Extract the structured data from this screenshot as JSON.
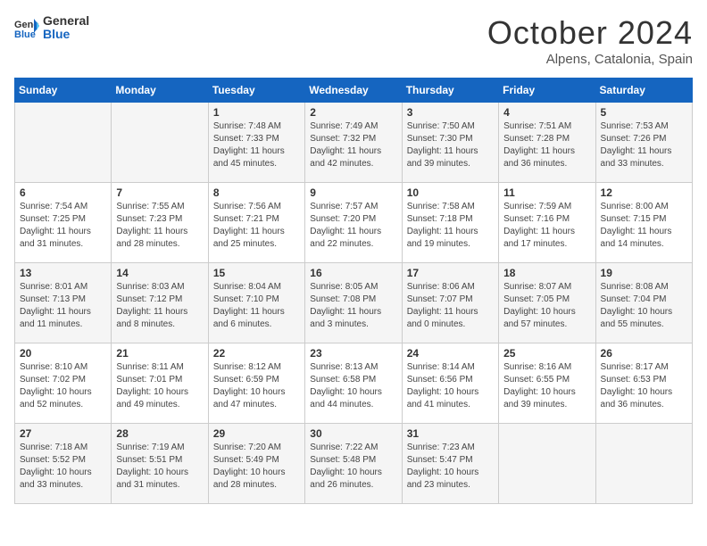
{
  "header": {
    "logo": {
      "general": "General",
      "blue": "Blue"
    },
    "title": "October 2024",
    "subtitle": "Alpens, Catalonia, Spain"
  },
  "days_of_week": [
    "Sunday",
    "Monday",
    "Tuesday",
    "Wednesday",
    "Thursday",
    "Friday",
    "Saturday"
  ],
  "weeks": [
    [
      {
        "day": "",
        "content": ""
      },
      {
        "day": "",
        "content": ""
      },
      {
        "day": "1",
        "content": "Sunrise: 7:48 AM\nSunset: 7:33 PM\nDaylight: 11 hours and 45 minutes."
      },
      {
        "day": "2",
        "content": "Sunrise: 7:49 AM\nSunset: 7:32 PM\nDaylight: 11 hours and 42 minutes."
      },
      {
        "day": "3",
        "content": "Sunrise: 7:50 AM\nSunset: 7:30 PM\nDaylight: 11 hours and 39 minutes."
      },
      {
        "day": "4",
        "content": "Sunrise: 7:51 AM\nSunset: 7:28 PM\nDaylight: 11 hours and 36 minutes."
      },
      {
        "day": "5",
        "content": "Sunrise: 7:53 AM\nSunset: 7:26 PM\nDaylight: 11 hours and 33 minutes."
      }
    ],
    [
      {
        "day": "6",
        "content": "Sunrise: 7:54 AM\nSunset: 7:25 PM\nDaylight: 11 hours and 31 minutes."
      },
      {
        "day": "7",
        "content": "Sunrise: 7:55 AM\nSunset: 7:23 PM\nDaylight: 11 hours and 28 minutes."
      },
      {
        "day": "8",
        "content": "Sunrise: 7:56 AM\nSunset: 7:21 PM\nDaylight: 11 hours and 25 minutes."
      },
      {
        "day": "9",
        "content": "Sunrise: 7:57 AM\nSunset: 7:20 PM\nDaylight: 11 hours and 22 minutes."
      },
      {
        "day": "10",
        "content": "Sunrise: 7:58 AM\nSunset: 7:18 PM\nDaylight: 11 hours and 19 minutes."
      },
      {
        "day": "11",
        "content": "Sunrise: 7:59 AM\nSunset: 7:16 PM\nDaylight: 11 hours and 17 minutes."
      },
      {
        "day": "12",
        "content": "Sunrise: 8:00 AM\nSunset: 7:15 PM\nDaylight: 11 hours and 14 minutes."
      }
    ],
    [
      {
        "day": "13",
        "content": "Sunrise: 8:01 AM\nSunset: 7:13 PM\nDaylight: 11 hours and 11 minutes."
      },
      {
        "day": "14",
        "content": "Sunrise: 8:03 AM\nSunset: 7:12 PM\nDaylight: 11 hours and 8 minutes."
      },
      {
        "day": "15",
        "content": "Sunrise: 8:04 AM\nSunset: 7:10 PM\nDaylight: 11 hours and 6 minutes."
      },
      {
        "day": "16",
        "content": "Sunrise: 8:05 AM\nSunset: 7:08 PM\nDaylight: 11 hours and 3 minutes."
      },
      {
        "day": "17",
        "content": "Sunrise: 8:06 AM\nSunset: 7:07 PM\nDaylight: 11 hours and 0 minutes."
      },
      {
        "day": "18",
        "content": "Sunrise: 8:07 AM\nSunset: 7:05 PM\nDaylight: 10 hours and 57 minutes."
      },
      {
        "day": "19",
        "content": "Sunrise: 8:08 AM\nSunset: 7:04 PM\nDaylight: 10 hours and 55 minutes."
      }
    ],
    [
      {
        "day": "20",
        "content": "Sunrise: 8:10 AM\nSunset: 7:02 PM\nDaylight: 10 hours and 52 minutes."
      },
      {
        "day": "21",
        "content": "Sunrise: 8:11 AM\nSunset: 7:01 PM\nDaylight: 10 hours and 49 minutes."
      },
      {
        "day": "22",
        "content": "Sunrise: 8:12 AM\nSunset: 6:59 PM\nDaylight: 10 hours and 47 minutes."
      },
      {
        "day": "23",
        "content": "Sunrise: 8:13 AM\nSunset: 6:58 PM\nDaylight: 10 hours and 44 minutes."
      },
      {
        "day": "24",
        "content": "Sunrise: 8:14 AM\nSunset: 6:56 PM\nDaylight: 10 hours and 41 minutes."
      },
      {
        "day": "25",
        "content": "Sunrise: 8:16 AM\nSunset: 6:55 PM\nDaylight: 10 hours and 39 minutes."
      },
      {
        "day": "26",
        "content": "Sunrise: 8:17 AM\nSunset: 6:53 PM\nDaylight: 10 hours and 36 minutes."
      }
    ],
    [
      {
        "day": "27",
        "content": "Sunrise: 7:18 AM\nSunset: 5:52 PM\nDaylight: 10 hours and 33 minutes."
      },
      {
        "day": "28",
        "content": "Sunrise: 7:19 AM\nSunset: 5:51 PM\nDaylight: 10 hours and 31 minutes."
      },
      {
        "day": "29",
        "content": "Sunrise: 7:20 AM\nSunset: 5:49 PM\nDaylight: 10 hours and 28 minutes."
      },
      {
        "day": "30",
        "content": "Sunrise: 7:22 AM\nSunset: 5:48 PM\nDaylight: 10 hours and 26 minutes."
      },
      {
        "day": "31",
        "content": "Sunrise: 7:23 AM\nSunset: 5:47 PM\nDaylight: 10 hours and 23 minutes."
      },
      {
        "day": "",
        "content": ""
      },
      {
        "day": "",
        "content": ""
      }
    ]
  ]
}
